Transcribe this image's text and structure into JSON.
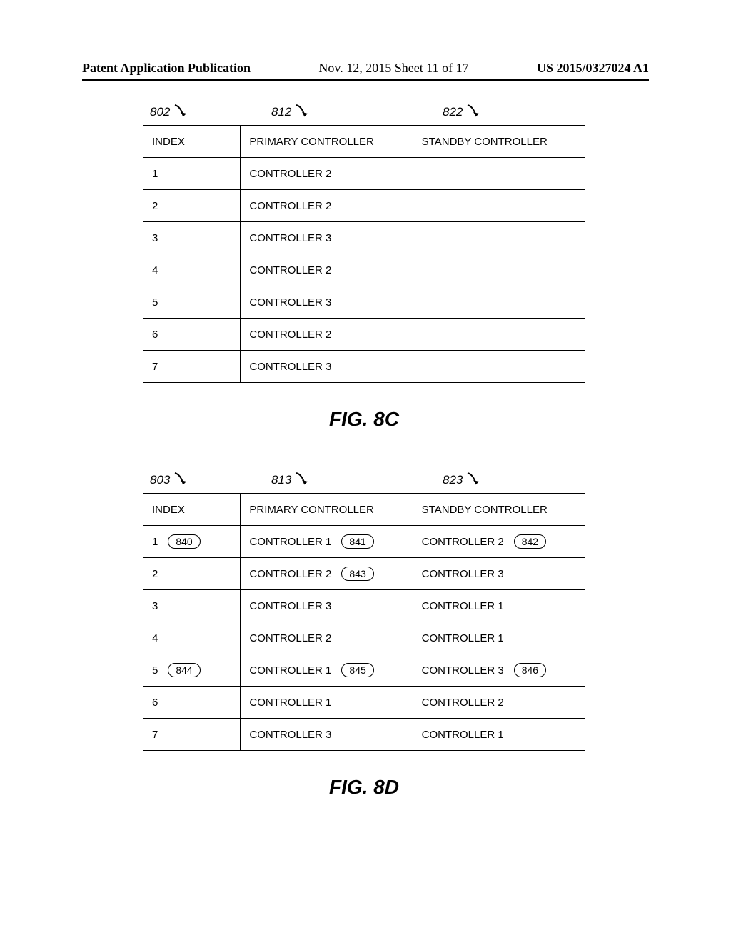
{
  "header": {
    "left": "Patent Application Publication",
    "mid": "Nov. 12, 2015  Sheet 11 of 17",
    "right": "US 2015/0327024 A1"
  },
  "figureC": {
    "refs": {
      "index": "802",
      "primary": "812",
      "standby": "822"
    },
    "headers": {
      "index": "INDEX",
      "primary": "PRIMARY CONTROLLER",
      "standby": "STANDBY CONTROLLER"
    },
    "rows": [
      {
        "index": "1",
        "primary": "CONTROLLER 2",
        "standby": ""
      },
      {
        "index": "2",
        "primary": "CONTROLLER 2",
        "standby": ""
      },
      {
        "index": "3",
        "primary": "CONTROLLER 3",
        "standby": ""
      },
      {
        "index": "4",
        "primary": "CONTROLLER 2",
        "standby": ""
      },
      {
        "index": "5",
        "primary": "CONTROLLER 3",
        "standby": ""
      },
      {
        "index": "6",
        "primary": "CONTROLLER 2",
        "standby": ""
      },
      {
        "index": "7",
        "primary": "CONTROLLER 3",
        "standby": ""
      }
    ],
    "caption": "FIG. 8C"
  },
  "figureD": {
    "refs": {
      "index": "803",
      "primary": "813",
      "standby": "823"
    },
    "headers": {
      "index": "INDEX",
      "primary": "PRIMARY CONTROLLER",
      "standby": "STANDBY CONTROLLER"
    },
    "rows": [
      {
        "index": "1",
        "indexCallout": "840",
        "primary": "CONTROLLER 1",
        "primaryCallout": "841",
        "standby": "CONTROLLER 2",
        "standbyCallout": "842"
      },
      {
        "index": "2",
        "primary": "CONTROLLER 2",
        "primaryCallout": "843",
        "standby": "CONTROLLER 3"
      },
      {
        "index": "3",
        "primary": "CONTROLLER 3",
        "standby": "CONTROLLER 1"
      },
      {
        "index": "4",
        "primary": "CONTROLLER 2",
        "standby": "CONTROLLER 1"
      },
      {
        "index": "5",
        "indexCallout": "844",
        "primary": "CONTROLLER 1",
        "primaryCallout": "845",
        "standby": "CONTROLLER 3",
        "standbyCallout": "846"
      },
      {
        "index": "6",
        "primary": "CONTROLLER 1",
        "standby": "CONTROLLER 2"
      },
      {
        "index": "7",
        "primary": "CONTROLLER 3",
        "standby": "CONTROLLER 1"
      }
    ],
    "caption": "FIG. 8D"
  }
}
